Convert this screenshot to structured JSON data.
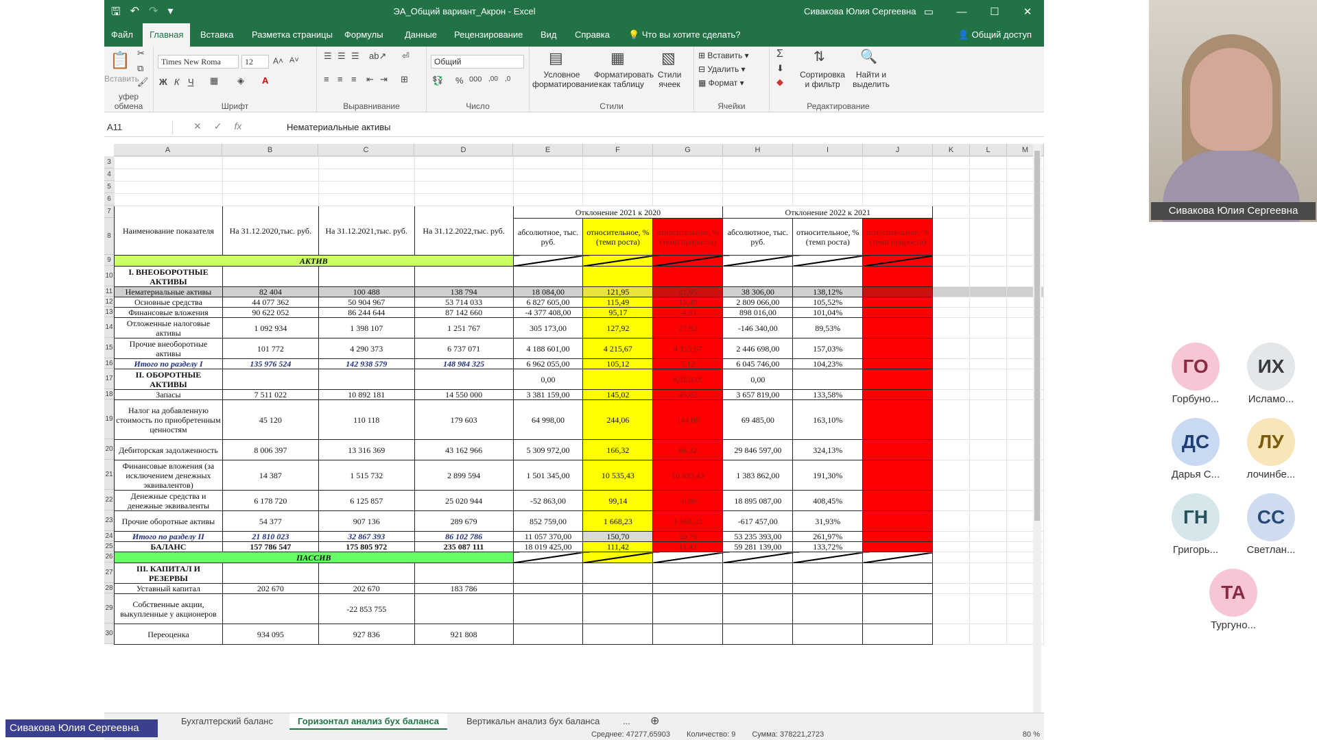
{
  "window": {
    "title": "ЭА_Общий вариант_Акрон  -  Excel",
    "user": "Сивакова Юлия Сергеевна"
  },
  "menu": {
    "tabs": [
      "Файл",
      "Главная",
      "Вставка",
      "Разметка страницы",
      "Формулы",
      "Данные",
      "Рецензирование",
      "Вид",
      "Справка"
    ],
    "tell_me": "Что вы хотите сделать?",
    "share": "Общий доступ"
  },
  "ribbon": {
    "clipboard_label": "уфер обмена",
    "paste_label": "Вставить",
    "font_label": "Шрифт",
    "font_name": "Times New Roma",
    "font_size": "12",
    "align_label": "Выравнивание",
    "number_label": "Число",
    "number_format": "Общий",
    "cond_format": "Условное форматирование",
    "format_table": "Форматировать как таблицу",
    "cell_styles": "Стили ячеек",
    "styles_label": "Стили",
    "insert": "Вставить",
    "delete": "Удалить",
    "format": "Формат",
    "cells_label": "Ячейки",
    "sort": "Сортировка и фильтр",
    "find": "Найти и выделить",
    "edit_label": "Редактирование"
  },
  "formula_bar": {
    "name_box": "A11",
    "formula": "Нематериальные активы"
  },
  "columns": [
    "A",
    "B",
    "C",
    "D",
    "E",
    "F",
    "G",
    "H",
    "I",
    "J",
    "K",
    "L",
    "M"
  ],
  "header": {
    "dev1": "Отклонение 2021 к 2020",
    "dev2": "Отклонение 2022 к 2021",
    "name": "Наименование показателя",
    "b": "На 31.12.2020,тыс. руб.",
    "c": "На 31.12.2021,тыс. руб.",
    "d": "На 31.12.2022,тыс. руб.",
    "abs": "абсолютное, тыс. руб.",
    "rel": "относительное, % (темп роста)",
    "growth": "относительное, % (темп прироста)"
  },
  "section_active": "АКТИВ",
  "section_passive": "ПАССИВ",
  "rows": [
    {
      "n": "10",
      "name": "I. ВНЕОБОРОТНЫЕ АКТИВЫ",
      "b": "",
      "c": "",
      "d": "",
      "e": "",
      "f": "",
      "g": "",
      "h": "",
      "i": ""
    },
    {
      "n": "11",
      "name": "Нематериальные активы",
      "b": "82 404",
      "c": "100 488",
      "d": "138 794",
      "e": "18 084,00",
      "f": "121,95",
      "g": "21,95",
      "h": "38 306,00",
      "i": "138,12%"
    },
    {
      "n": "12",
      "name": "Основные средства",
      "b": "44 077 362",
      "c": "50 904 967",
      "d": "53 714 033",
      "e": "6 827 605,00",
      "f": "115,49",
      "g": "15,49",
      "h": "2 809 066,00",
      "i": "105,52%"
    },
    {
      "n": "13",
      "name": "Финансовые вложения",
      "b": "90 622 052",
      "c": "86 244 644",
      "d": "87 142 660",
      "e": "-4 377 408,00",
      "f": "95,17",
      "g": "-4,83",
      "h": "898 016,00",
      "i": "101,04%"
    },
    {
      "n": "14",
      "name": "Отложенные налоговые активы",
      "b": "1 092 934",
      "c": "1 398 107",
      "d": "1 251 767",
      "e": "305 173,00",
      "f": "127,92",
      "g": "27,92",
      "h": "-146 340,00",
      "i": "89,53%"
    },
    {
      "n": "15",
      "name": "Прочие внеоборотные активы",
      "b": "101 772",
      "c": "4 290 373",
      "d": "6 737 071",
      "e": "4 188 601,00",
      "f": "4 215,67",
      "g": "4 115,67",
      "h": "2 446 698,00",
      "i": "157,03%"
    },
    {
      "n": "16",
      "name": "Итого по разделу I",
      "b": "135 976 524",
      "c": "142 938 579",
      "d": "148 984 325",
      "e": "6 962 055,00",
      "f": "105,12",
      "g": "5,12",
      "h": "6 045 746,00",
      "i": "104,23%"
    },
    {
      "n": "17",
      "name": "II. ОБОРОТНЫЕ АКТИВЫ",
      "b": "",
      "c": "",
      "d": "",
      "e": "0,00",
      "f": "",
      "g": "#ДЕЛ/0!",
      "h": "0,00",
      "i": ""
    },
    {
      "n": "18",
      "name": "Запасы",
      "b": "7 511 022",
      "c": "10 892 181",
      "d": "14 550 000",
      "e": "3 381 159,00",
      "f": "145,02",
      "g": "45,02",
      "h": "3 657 819,00",
      "i": "133,58%"
    },
    {
      "n": "19",
      "name": "Налог на добавленную стоимость по приобретенным ценностям",
      "b": "45 120",
      "c": "110 118",
      "d": "179 603",
      "e": "64 998,00",
      "f": "244,06",
      "g": "144,06",
      "h": "69 485,00",
      "i": "163,10%"
    },
    {
      "n": "20",
      "name": "Дебиторская задолженность",
      "b": "8 006 397",
      "c": "13 316 369",
      "d": "43 162 966",
      "e": "5 309 972,00",
      "f": "166,32",
      "g": "66,32",
      "h": "29 846 597,00",
      "i": "324,13%"
    },
    {
      "n": "21",
      "name": "Финансовые вложения (за исключением денежных эквивалентов)",
      "b": "14 387",
      "c": "1 515 732",
      "d": "2 899 594",
      "e": "1 501 345,00",
      "f": "10 535,43",
      "g": "10 435,43",
      "h": "1 383 862,00",
      "i": "191,30%"
    },
    {
      "n": "22",
      "name": "Денежные средства и денежные эквиваленты",
      "b": "6 178 720",
      "c": "6 125 857",
      "d": "25 020 944",
      "e": "-52 863,00",
      "f": "99,14",
      "g": "-0,86",
      "h": "18 895 087,00",
      "i": "408,45%"
    },
    {
      "n": "23",
      "name": "Прочие оборотные активы",
      "b": "54 377",
      "c": "907 136",
      "d": "289 679",
      "e": "852 759,00",
      "f": "1 668,23",
      "g": "1 568,23",
      "h": "-617 457,00",
      "i": "31,93%"
    },
    {
      "n": "24",
      "name": "Итого по разделу II",
      "b": "21 810 023",
      "c": "32 867 393",
      "d": "86 102 786",
      "e": "11 057 370,00",
      "f": "150,70",
      "g": "50,70",
      "h": "53 235 393,00",
      "i": "261,97%"
    },
    {
      "n": "25",
      "name": "БАЛАНС",
      "b": "157 786 547",
      "c": "175 805 972",
      "d": "235 087 111",
      "e": "18 019 425,00",
      "f": "111,42",
      "g": "11,42",
      "h": "59 281 139,00",
      "i": "133,72%"
    }
  ],
  "passive_rows": [
    {
      "n": "27",
      "name": "III. КАПИТАЛ И РЕЗЕРВЫ",
      "b": "",
      "c": "",
      "d": ""
    },
    {
      "n": "28",
      "name": "Уставный капитал",
      "b": "202 670",
      "c": "202 670",
      "d": "183 786"
    },
    {
      "n": "29",
      "name": "Собственные акции, выкупленные у акционеров",
      "b": "",
      "c": "-22 853 755",
      "d": ""
    },
    {
      "n": "30",
      "name": "Переоценка",
      "b": "934 095",
      "c": "927 836",
      "d": "921 808"
    }
  ],
  "sheet_tabs": [
    "Бухгалтерский баланс",
    "Горизонтал анализ бух баланса",
    "Вертикальн анализ бух баланса",
    "..."
  ],
  "status": {
    "avg": "Среднее: 47277,65903",
    "count": "Количество: 9",
    "sum": "Сумма: 378221,2723",
    "zoom": "80 %"
  },
  "meeting": {
    "speaker": "Сивакова Юлия Сергеевна",
    "presenter": "Сивакова Юлия Сергеевна",
    "participants": [
      {
        "initials": "ГО",
        "name": "Горбуно...",
        "color": "#f6c6d4",
        "text": "#8a2a46"
      },
      {
        "initials": "ИХ",
        "name": "Исламо...",
        "color": "#e3e6ea",
        "text": "#3a3a3a"
      },
      {
        "initials": "ДС",
        "name": "Дарья С...",
        "color": "#c9d9f2",
        "text": "#1f3e78"
      },
      {
        "initials": "ЛУ",
        "name": "лочинбе...",
        "color": "#f8e6b8",
        "text": "#7a5a0c"
      },
      {
        "initials": "ГН",
        "name": "Григорь...",
        "color": "#d6e6ea",
        "text": "#28525c"
      },
      {
        "initials": "СС",
        "name": "Светлан...",
        "color": "#cfdcf0",
        "text": "#274a7a"
      },
      {
        "initials": "ТА",
        "name": "Тургуно...",
        "color": "#f6c6d4",
        "text": "#8a2a46"
      }
    ]
  },
  "colors": {
    "excel_green": "#217346",
    "yellow": "#ffff00",
    "red": "#ff0000",
    "green_section": "#ccff66"
  }
}
